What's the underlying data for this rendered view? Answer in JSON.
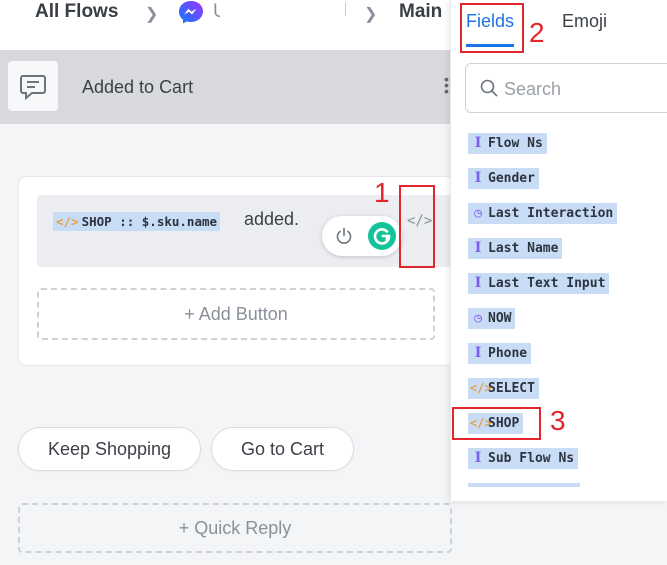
{
  "breadcrumb": {
    "all_flows": "All Flows",
    "flow_initial": "U",
    "main": "Main"
  },
  "header": {
    "title": "Added to Cart"
  },
  "message": {
    "variable": "SHOP :: $.sku.name",
    "text": "added."
  },
  "buttons": {
    "add_button": "+ Add Button",
    "quick_reply_1": "Keep Shopping",
    "quick_reply_2": "Go to Cart",
    "add_quick_reply": "+ Quick Reply"
  },
  "panel": {
    "tabs": [
      "Fields",
      "Emoji"
    ],
    "search_placeholder": "Search",
    "fields": [
      {
        "label": "Flow Ns",
        "icon": "text-icon"
      },
      {
        "label": "Gender",
        "icon": "text-icon"
      },
      {
        "label": "Last Interaction",
        "icon": "clock-icon"
      },
      {
        "label": "Last Name",
        "icon": "text-icon"
      },
      {
        "label": "Last Text Input",
        "icon": "text-icon"
      },
      {
        "label": "NOW",
        "icon": "clock-icon"
      },
      {
        "label": "Phone",
        "icon": "text-icon"
      },
      {
        "label": "SELECT",
        "icon": "code-icon"
      },
      {
        "label": "SHOP",
        "icon": "code-icon"
      },
      {
        "label": "Sub Flow Ns",
        "icon": "text-icon"
      }
    ]
  },
  "annotations": {
    "step1": "1",
    "step2": "2",
    "step3": "3",
    "color": "#e3262b"
  },
  "colors": {
    "accent": "#1a73e8",
    "chip_bg": "#c9dcf5",
    "grammarly": "#15c39a"
  }
}
